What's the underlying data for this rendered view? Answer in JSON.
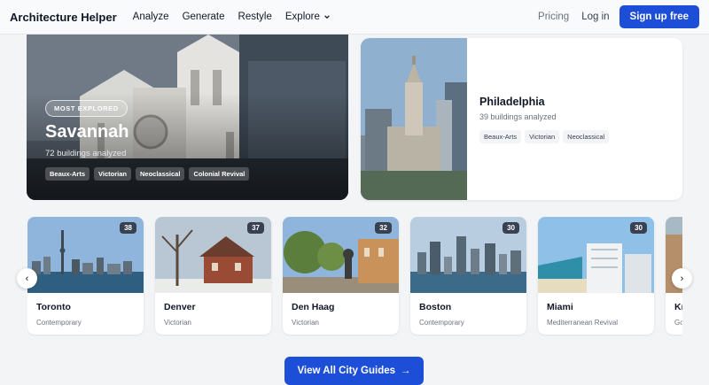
{
  "nav": {
    "brand": "Architecture Helper",
    "links": [
      "Analyze",
      "Generate",
      "Restyle",
      "Explore"
    ],
    "pricing": "Pricing",
    "login": "Log in",
    "signup": "Sign up free"
  },
  "featured": {
    "badge": "MOST EXPLORED",
    "title": "Savannah",
    "subtitle": "72 buildings analyzed",
    "tags": [
      "Beaux-Arts",
      "Victorian",
      "Neoclassical",
      "Colonial Revival"
    ]
  },
  "secondary": {
    "title": "Philadelphia",
    "subtitle": "39 buildings analyzed",
    "tags": [
      "Beaux-Arts",
      "Victorian",
      "Neoclassical"
    ]
  },
  "cities": [
    {
      "name": "Toronto",
      "style": "Contemporary",
      "count": "38"
    },
    {
      "name": "Denver",
      "style": "Victorian",
      "count": "37"
    },
    {
      "name": "Den Haag",
      "style": "Victorian",
      "count": "32"
    },
    {
      "name": "Boston",
      "style": "Contemporary",
      "count": "30"
    },
    {
      "name": "Miami",
      "style": "Mediterranean Revival",
      "count": "30"
    },
    {
      "name": "Kr",
      "style": "Go",
      "count": ""
    }
  ],
  "controls": {
    "prev": "‹",
    "next": "›",
    "view_all": "View All City Guides",
    "view_all_arrow": "→"
  },
  "icons": [
    "chevron-down-icon",
    "chevron-left-icon",
    "chevron-right-icon",
    "arrow-right-icon"
  ],
  "colors": {
    "accent": "#1d4ed8",
    "badge": "#374151"
  }
}
